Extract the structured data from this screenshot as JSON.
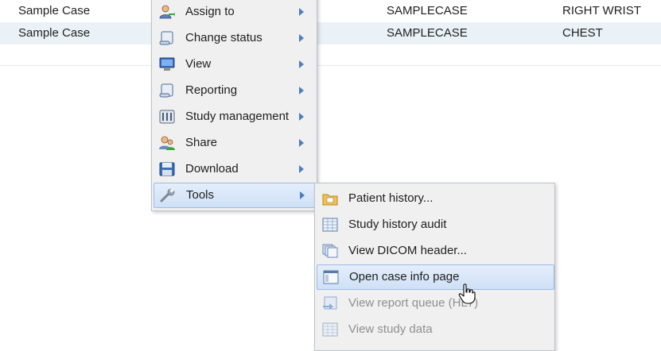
{
  "table": {
    "rows": [
      {
        "name": "Sample Case",
        "id": "SAMPLECASE",
        "body_part": "RIGHT WRIST"
      },
      {
        "name": "Sample Case",
        "id": "SAMPLECASE",
        "body_part": "CHEST"
      }
    ]
  },
  "context_menu": {
    "items": [
      {
        "label": "Assign to",
        "icon": "assign-user-icon"
      },
      {
        "label": "Change status",
        "icon": "scroll-icon"
      },
      {
        "label": "View",
        "icon": "monitor-icon"
      },
      {
        "label": "Reporting",
        "icon": "scroll-icon"
      },
      {
        "label": "Study management",
        "icon": "study-management-icon"
      },
      {
        "label": "Share",
        "icon": "share-users-icon"
      },
      {
        "label": "Download",
        "icon": "floppy-disk-icon"
      },
      {
        "label": "Tools",
        "icon": "wrench-icon",
        "highlighted": true
      }
    ]
  },
  "tools_submenu": {
    "items": [
      {
        "label": "Patient history...",
        "icon": "folder-icon"
      },
      {
        "label": "Study history audit",
        "icon": "table-grid-icon"
      },
      {
        "label": "View DICOM header...",
        "icon": "stacked-pages-icon"
      },
      {
        "label": "Open case info page",
        "icon": "window-page-icon",
        "highlighted": true
      },
      {
        "label": "View report queue (HL7)",
        "icon": "report-queue-icon",
        "disabled": true
      },
      {
        "label": "View study data",
        "icon": "table-grid-icon",
        "disabled": true
      }
    ]
  },
  "colors": {
    "menu_bg": "#f0f0f0",
    "highlight": "#cfe0f6",
    "submenu_arrow": "#4a7fc0",
    "selected_row": "#eaf2f7"
  }
}
